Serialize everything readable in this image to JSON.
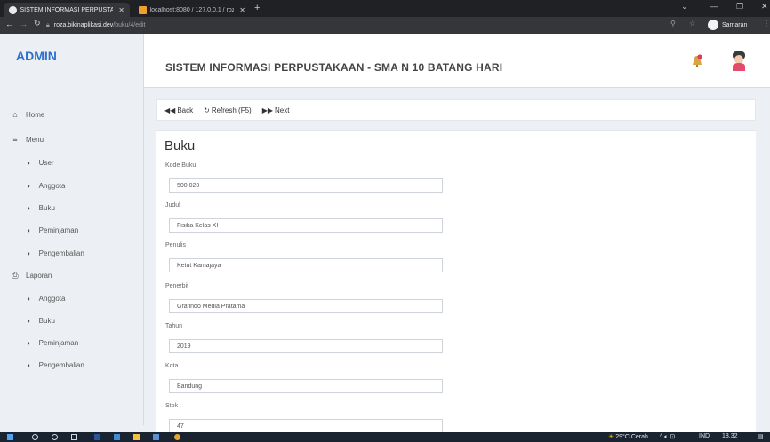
{
  "browser": {
    "tabs": [
      {
        "title": "SISTEM INFORMASI PERPUSTAK",
        "fav_color": "#e8eaed"
      },
      {
        "title": "localhost:8080 / 127.0.0.1 / roza",
        "fav_color": "#f0a030"
      }
    ],
    "new_tab": "+",
    "url_host": "roza.bikinaplikasi.dev",
    "url_path": "/buku/4/edit",
    "profile_name": "Samaran"
  },
  "header": {
    "logo": "ADMIN",
    "title": "SISTEM INFORMASI PERPUSTAKAAN - SMA N 10 BATANG HARI"
  },
  "sidebar": {
    "home": "Home",
    "menu": "Menu",
    "menu_items": [
      "User",
      "Anggota",
      "Buku",
      "Peminjaman",
      "Pengembalian"
    ],
    "laporan": "Laporan",
    "laporan_items": [
      "Anggota",
      "Buku",
      "Peminjaman",
      "Pengembalian"
    ]
  },
  "toolbar": {
    "back": "Back",
    "refresh": "Refresh (F5)",
    "next": "Next"
  },
  "form": {
    "title": "Buku",
    "fields": [
      {
        "label": "Kode Buku",
        "value": "500.028"
      },
      {
        "label": "Judul",
        "value": "Fisika Kelas XI"
      },
      {
        "label": "Penulis",
        "value": "Ketut Kamajaya"
      },
      {
        "label": "Penerbit",
        "value": "Grafindo Media Pratama"
      },
      {
        "label": "Tahun",
        "value": "2019"
      },
      {
        "label": "Kota",
        "value": "Bandung"
      },
      {
        "label": "Stok",
        "value": "47"
      }
    ]
  },
  "taskbar": {
    "weather": "29°C Cerah",
    "lang": "IND",
    "time": "18.32"
  },
  "colors": {
    "accent": "#2a6fd1",
    "sidebar_bg": "#ecf0f5",
    "taskbar_bg": "#1a2330"
  }
}
